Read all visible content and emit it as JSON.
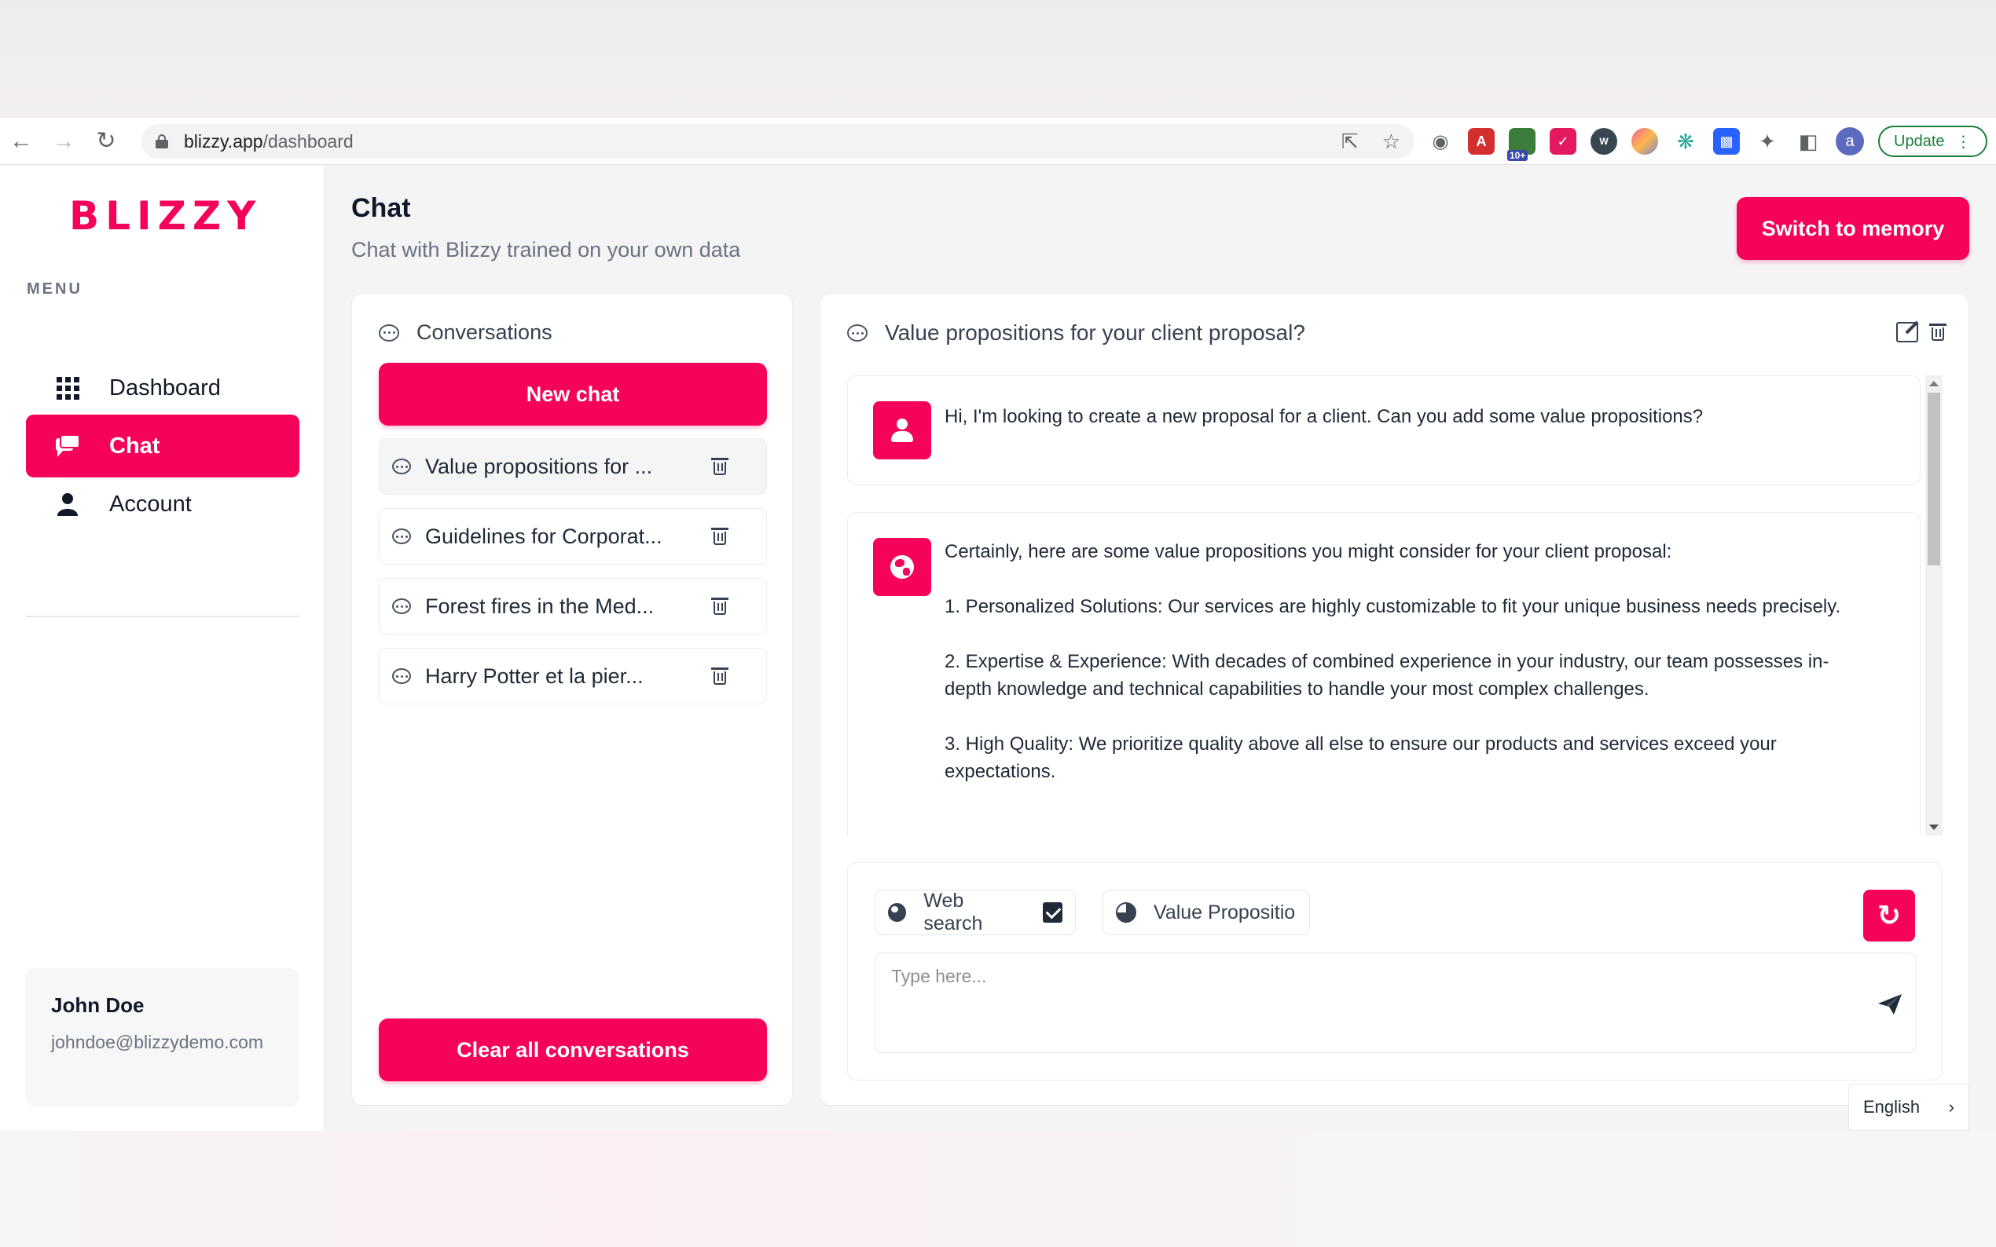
{
  "browser": {
    "url_host": "blizzy.app",
    "url_path": "/dashboard",
    "extension_badge": "10+",
    "profile_initial": "a",
    "update_label": "Update"
  },
  "sidebar": {
    "logo_text": "BLIZZY",
    "menu_label": "MENU",
    "items": [
      {
        "label": "Dashboard",
        "icon": "grid-icon",
        "active": false
      },
      {
        "label": "Chat",
        "icon": "chat-icon",
        "active": true
      },
      {
        "label": "Account",
        "icon": "person-icon",
        "active": false
      }
    ],
    "user": {
      "name": "John Doe",
      "email": "johndoe@blizzydemo.com"
    }
  },
  "header": {
    "title": "Chat",
    "subtitle": "Chat with Blizzy trained on your own data",
    "switch_button": "Switch to memory"
  },
  "conversations": {
    "heading": "Conversations",
    "new_chat_label": "New chat",
    "items": [
      {
        "title": "Value propositions for ...",
        "selected": true
      },
      {
        "title": "Guidelines for Corporat...",
        "selected": false
      },
      {
        "title": "Forest fires in the Med...",
        "selected": false
      },
      {
        "title": "Harry Potter et la pier...",
        "selected": false
      }
    ],
    "clear_label": "Clear all conversations"
  },
  "chat": {
    "title": "Value propositions for your client proposal?",
    "messages": [
      {
        "role": "user",
        "paragraphs": [
          "Hi, I'm looking to create a new proposal for a client. Can you add some value propositions?"
        ]
      },
      {
        "role": "assistant",
        "paragraphs": [
          "Certainly, here are some value propositions you might consider for your client proposal:",
          "1. Personalized Solutions: Our services are highly customizable to fit your unique business needs precisely.",
          "2. Expertise & Experience: With decades of combined experience in your industry, our team possesses in-depth knowledge and technical capabilities to handle your most complex challenges.",
          "3. High Quality: We prioritize quality above all else to ensure our products and services exceed your expectations."
        ]
      }
    ],
    "web_search_label": "Web search",
    "web_search_checked": true,
    "source_label": "Value Propositio",
    "input_placeholder": "Type here..."
  },
  "language": {
    "label": "English"
  },
  "colors": {
    "accent": "#f5035a",
    "background": "#f4f4f5"
  }
}
